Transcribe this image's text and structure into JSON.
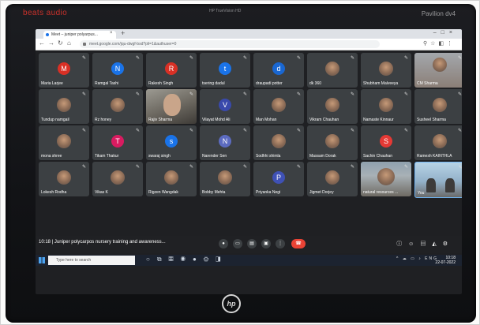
{
  "laptop": {
    "brand_left": "beats audio",
    "model_mid": "HP TrueVision HD",
    "model_right": "Pavilion dv4",
    "logo": "hp"
  },
  "browser": {
    "tab_title": "Meet – juniper polyarpus...",
    "url": "meet.google.com/jqu-dwgf-bsd?pli=1&authuser=0"
  },
  "participants": [
    {
      "name": "Maria Larjee",
      "type": "letter",
      "letter": "M",
      "color": "#d93025"
    },
    {
      "name": "Ramgal Tashi",
      "type": "letter",
      "letter": "N",
      "color": "#1a73e8"
    },
    {
      "name": "Rakesh Singh",
      "type": "letter",
      "letter": "R",
      "color": "#d93025"
    },
    {
      "name": "tsering dadul",
      "type": "letter",
      "letter": "t",
      "color": "#1a73e8"
    },
    {
      "name": "draupadi potter",
      "type": "letter",
      "letter": "d",
      "color": "#1967d2"
    },
    {
      "name": "dk 360",
      "type": "photo"
    },
    {
      "name": "Shubham Malveeya",
      "type": "photo"
    },
    {
      "name": "CM Sharma",
      "type": "video3"
    },
    {
      "name": "Tundup namgail",
      "type": "photo"
    },
    {
      "name": "Rz honey",
      "type": "photo"
    },
    {
      "name": "Rajiv Sharma",
      "type": "video"
    },
    {
      "name": "Vilayat Mohd Ali",
      "type": "letter",
      "letter": "V",
      "color": "#3949ab"
    },
    {
      "name": "Man Mohan",
      "type": "photo"
    },
    {
      "name": "Vikram Chauhan",
      "type": "photo"
    },
    {
      "name": "Namaste Kinnaur",
      "type": "photo"
    },
    {
      "name": "Susheel Sharma",
      "type": "photo"
    },
    {
      "name": "mona shree",
      "type": "photo"
    },
    {
      "name": "Tikam Thakur",
      "type": "letter",
      "letter": "T",
      "color": "#d81b60"
    },
    {
      "name": "swaraj singh",
      "type": "letter",
      "letter": "s",
      "color": "#1a73e8"
    },
    {
      "name": "Narender Sen",
      "type": "letter",
      "letter": "N",
      "color": "#5c6bc0"
    },
    {
      "name": "Sodhhi shimla",
      "type": "photo"
    },
    {
      "name": "Massam Dorak",
      "type": "photo"
    },
    {
      "name": "Sachin Chauhan",
      "type": "letter",
      "letter": "S",
      "color": "#e53935"
    },
    {
      "name": "Ramesh KAINTHLA",
      "type": "photo"
    },
    {
      "name": "Lokesh Rodha",
      "type": "photo"
    },
    {
      "name": "Vikas K",
      "type": "photo"
    },
    {
      "name": "Rigzen Wangdak",
      "type": "photo"
    },
    {
      "name": "Bobby Mehta",
      "type": "photo"
    },
    {
      "name": "Priyanka Negi",
      "type": "letter",
      "letter": "P",
      "color": "#3f51b5"
    },
    {
      "name": "Jigmet Dorjey",
      "type": "photo"
    },
    {
      "name": "natural resources ...",
      "type": "video2"
    },
    {
      "name": "You",
      "type": "video4"
    }
  ],
  "meeting": {
    "time": "10:18",
    "title": "Juniper polycarpos nursery training and awareness..."
  },
  "taskbar": {
    "search_placeholder": "Type here to search",
    "language": "ENG",
    "time": "10:18",
    "date": "22-07-2022"
  }
}
